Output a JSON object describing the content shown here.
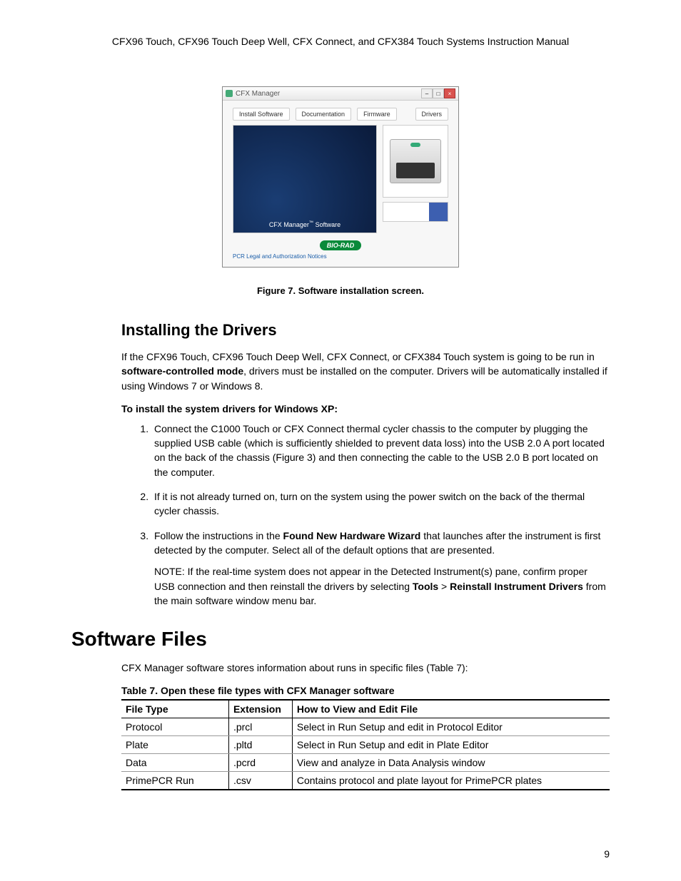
{
  "running_head": "CFX96 Touch, CFX96 Touch Deep Well, CFX Connect, and CFX384 Touch Systems Instruction Manual",
  "installer": {
    "title": "CFX Manager",
    "tabs": [
      "Install Software",
      "Documentation",
      "Firmware",
      "Drivers"
    ],
    "left_caption_prefix": "CFX Manager",
    "left_caption_suffix": " Software",
    "brand": "BIO-RAD",
    "legal": "PCR Legal and Authorization Notices"
  },
  "figure_caption": "Figure 7. Software installation screen.",
  "section_heading": "Installing the Drivers",
  "intro_a": "If the CFX96 Touch, CFX96 Touch Deep Well, CFX Connect, or CFX384 Touch system is going to be run in ",
  "intro_bold": "software-controlled mode",
  "intro_b": ", drivers must be installed on the computer. Drivers will be automatically installed if using Windows 7 or Windows 8.",
  "sub_heading": "To install the system drivers for Windows XP:",
  "steps": {
    "s1": "Connect the C1000 Touch or CFX Connect thermal cycler chassis to the computer by plugging the supplied USB cable (which is sufficiently shielded to prevent data loss) into the USB 2.0 A port located on the back of the chassis (Figure 3) and then connecting the cable to the USB 2.0 B port located on the computer.",
    "s2": "If it is not already turned on, turn on the system using the power switch on the back of the thermal cycler chassis.",
    "s3a": "Follow the instructions in the ",
    "s3bold": "Found New Hardware Wizard",
    "s3b": " that launches after the instrument is first detected by the computer. Select all of the default options that are presented.",
    "note_a": "NOTE: If the real-time system does not appear in the Detected Instrument(s) pane, confirm proper USB connection and then reinstall the drivers by selecting ",
    "note_tools": "Tools",
    "note_gt": " > ",
    "note_reinstall": "Reinstall Instrument Drivers",
    "note_b": " from the main software window menu bar."
  },
  "major_heading": "Software Files",
  "files_intro": "CFX Manager software stores information about runs in specific files (Table 7):",
  "table_caption": "Table 7. Open these file types with CFX Manager software",
  "table_headers": {
    "c1": "File Type",
    "c2": "Extension",
    "c3": "How to View and Edit File"
  },
  "table_rows": [
    {
      "c1": "Protocol",
      "c2": ".prcl",
      "c3": "Select in Run Setup and edit in Protocol Editor"
    },
    {
      "c1": "Plate",
      "c2": ".pltd",
      "c3": "Select in Run Setup and edit in Plate Editor"
    },
    {
      "c1": "Data",
      "c2": ".pcrd",
      "c3": "View and analyze in Data Analysis window"
    },
    {
      "c1": "PrimePCR Run",
      "c2": ".csv",
      "c3": "Contains protocol and plate layout for PrimePCR plates"
    }
  ],
  "page_number": "9"
}
